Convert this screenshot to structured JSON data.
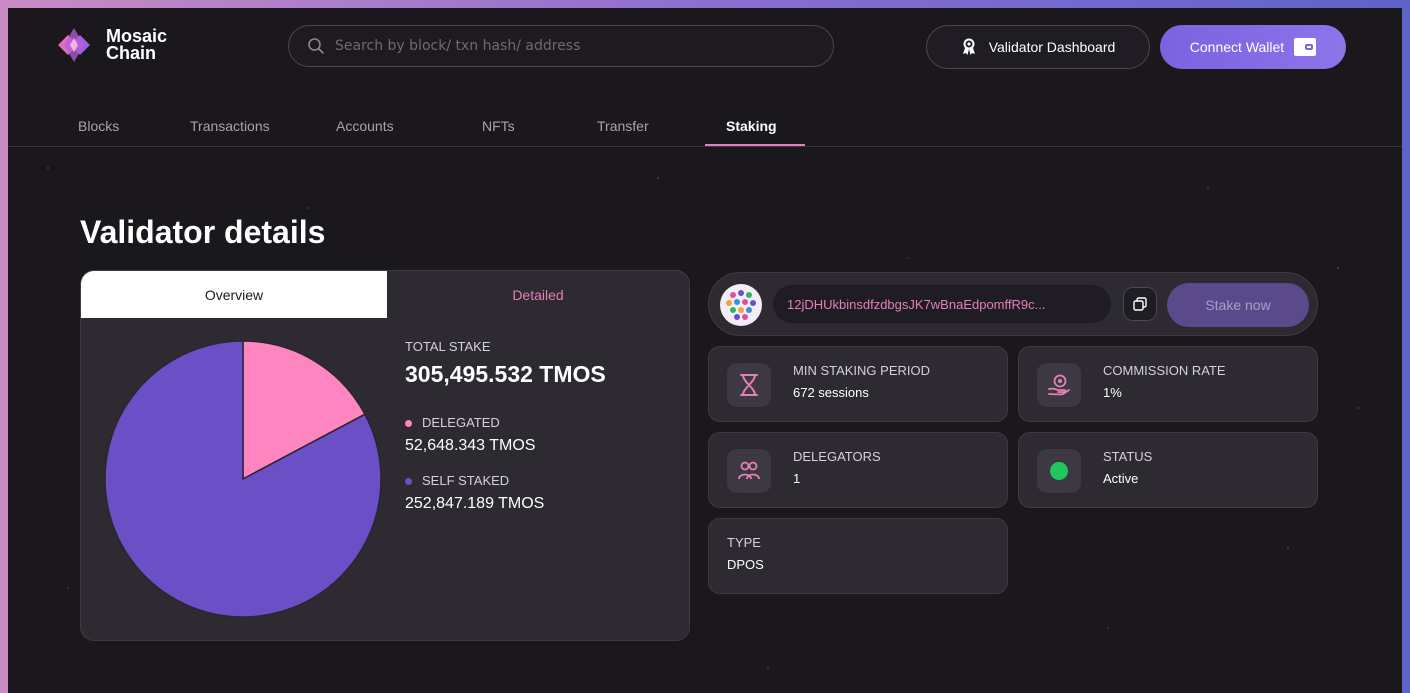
{
  "brand": {
    "name_line1": "Mosaic",
    "name_line2": "Chain"
  },
  "search": {
    "placeholder": "Search by block/ txn hash/ address"
  },
  "header": {
    "validator_dashboard_label": "Validator Dashboard",
    "connect_wallet_label": "Connect Wallet"
  },
  "nav": {
    "tabs": [
      {
        "label": "Blocks",
        "active": false
      },
      {
        "label": "Transactions",
        "active": false
      },
      {
        "label": "Accounts",
        "active": false
      },
      {
        "label": "NFTs",
        "active": false
      },
      {
        "label": "Transfer",
        "active": false
      },
      {
        "label": "Staking",
        "active": true
      }
    ]
  },
  "page": {
    "title": "Validator details"
  },
  "overview_card": {
    "segments": {
      "overview": "Overview",
      "detailed": "Detailed"
    },
    "total_stake_label": "TOTAL STAKE",
    "total_stake_value": "305,495.532 TMOS",
    "delegated_label": "DELEGATED",
    "delegated_value": "52,648.343 TMOS",
    "self_staked_label": "SELF STAKED",
    "self_staked_value": "252,847.189 TMOS"
  },
  "chart_data": {
    "type": "pie",
    "categories": [
      "DELEGATED",
      "SELF STAKED"
    ],
    "values": [
      52648.343,
      252847.189
    ],
    "colors": [
      "#ff85c0",
      "#6b4fc7"
    ]
  },
  "validator": {
    "address": "12jDHUkbinsdfzdbgsJK7wBnaEdpomffR9c...",
    "stake_now_label": "Stake now"
  },
  "tiles": {
    "min_staking_label": "MIN STAKING PERIOD",
    "min_staking_value": "672 sessions",
    "commission_label": "COMMISSION RATE",
    "commission_value": "1%",
    "delegators_label": "DELEGATORS",
    "delegators_value": "1",
    "status_label": "STATUS",
    "status_value": "Active",
    "type_label": "TYPE",
    "type_value": "DPOS"
  },
  "colors": {
    "accent_pink": "#e57fb8",
    "accent_purple": "#7b62e0",
    "status_green": "#22c55e"
  }
}
